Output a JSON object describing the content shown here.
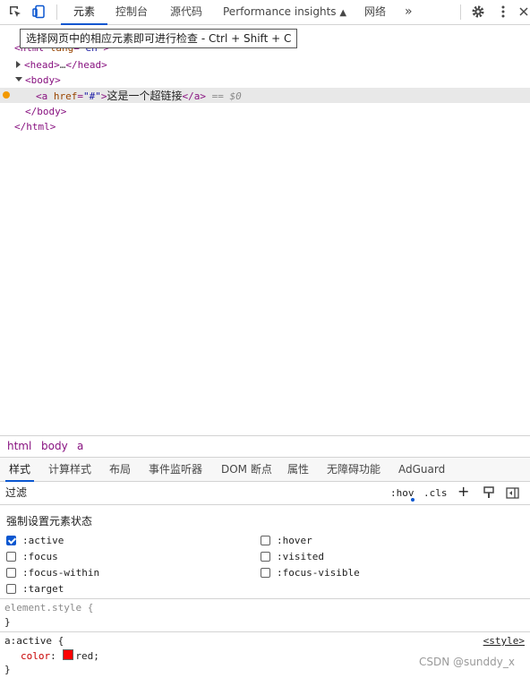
{
  "toolbar": {
    "tabs": [
      "元素",
      "控制台",
      "源代码",
      "Performance insights",
      "网络"
    ],
    "more": "»"
  },
  "tooltip": "选择网页中的相应元素即可进行检查 - Ctrl + Shift + C",
  "dom": {
    "html_open_tag": "html",
    "html_attr_name": "lang",
    "html_attr_value": "en",
    "head_open": "<head>",
    "head_ellipsis": "…",
    "head_close": "</head>",
    "body_open": "<body>",
    "a_open_start": "<a",
    "a_attr_name": "href",
    "a_attr_value": "\"#\"",
    "a_open_end": ">",
    "a_text": "这是一个超链接",
    "a_close": "</a>",
    "a_marker": "== $0",
    "body_close": "</body>",
    "html_close": "</html>"
  },
  "breadcrumb": [
    "html",
    "body",
    "a"
  ],
  "subtabs": [
    "样式",
    "计算样式",
    "布局",
    "事件监听器",
    "DOM 断点",
    "属性",
    "无障碍功能",
    "AdGuard"
  ],
  "filter": {
    "placeholder": "过滤",
    "hov": ":hov",
    "cls": ".cls",
    "add": "+"
  },
  "state_pane": {
    "title": "强制设置元素状态",
    "states": [
      {
        "label": ":active",
        "checked": true
      },
      {
        "label": ":hover",
        "checked": false
      },
      {
        "label": ":focus",
        "checked": false
      },
      {
        "label": ":visited",
        "checked": false
      },
      {
        "label": ":focus-within",
        "checked": false
      },
      {
        "label": ":focus-visible",
        "checked": false
      },
      {
        "label": ":target",
        "checked": false
      }
    ]
  },
  "styles": {
    "element_style": "element.style {",
    "element_close": "}",
    "rule_selector": "a:active {",
    "rule_source": "<style>",
    "prop_name": "color",
    "prop_value": "red",
    "prop_color": "#ff0000",
    "rule_close": "}"
  },
  "watermark": "CSDN @sunddy_x",
  "colors": {
    "accent": "#0b57d0",
    "tag": "#881280",
    "attr_name": "#994500",
    "attr_value": "#1a1aa6",
    "property": "#c80000"
  }
}
